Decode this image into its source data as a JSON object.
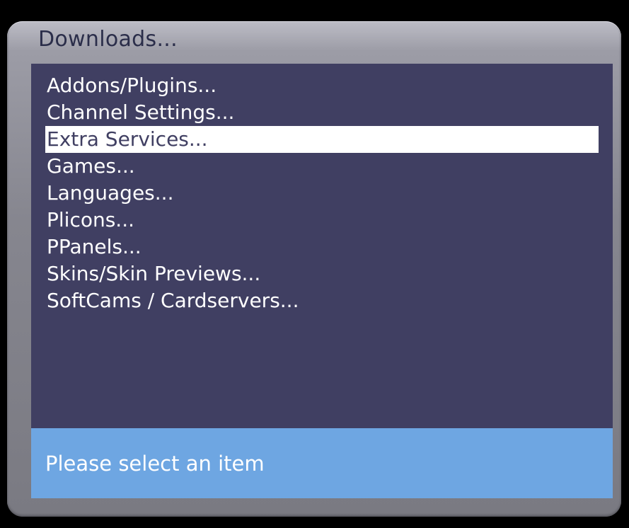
{
  "window": {
    "title": "Downloads..."
  },
  "menu": {
    "selected_index": 2,
    "items": [
      {
        "label": "Addons/Plugins..."
      },
      {
        "label": "Channel Settings..."
      },
      {
        "label": "Extra Services..."
      },
      {
        "label": "Games..."
      },
      {
        "label": "Languages..."
      },
      {
        "label": "Plicons..."
      },
      {
        "label": "PPanels..."
      },
      {
        "label": "Skins/Skin Previews..."
      },
      {
        "label": "SoftCams / Cardservers..."
      }
    ]
  },
  "status": {
    "text": "Please select an item"
  },
  "colors": {
    "list_background": "#403f62",
    "selection_background": "#ffffff",
    "selection_text": "#403f62",
    "status_background": "#6ea6e2",
    "title_text": "#2b2e4a"
  }
}
